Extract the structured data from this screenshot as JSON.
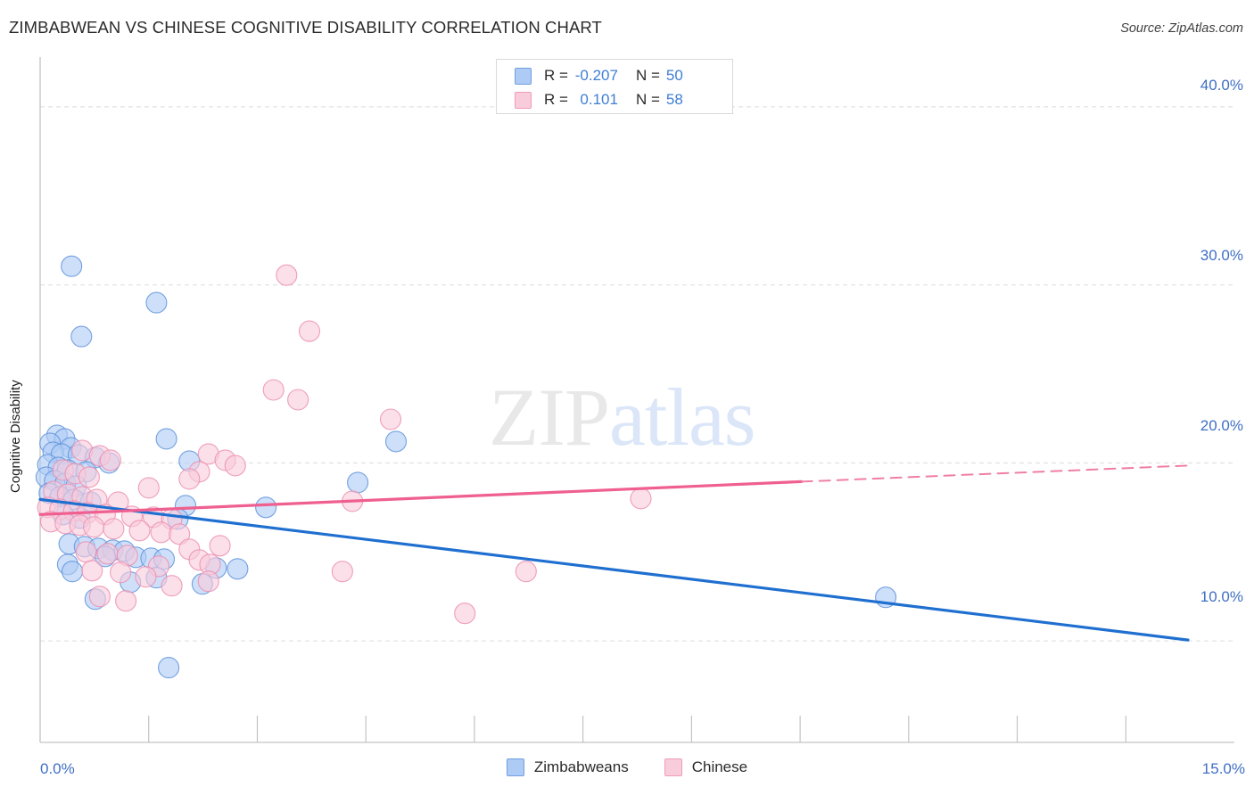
{
  "header": {
    "title": "ZIMBABWEAN VS CHINESE COGNITIVE DISABILITY CORRELATION CHART",
    "source": "Source: ZipAtlas.com"
  },
  "watermark": {
    "part1": "ZIP",
    "part2": "atlas"
  },
  "stats": {
    "rows": [
      {
        "r_label": "R =",
        "r_value": "-0.207",
        "n_label": "N =",
        "n_value": "50",
        "color": "#aecbf5"
      },
      {
        "r_label": "R =",
        "r_value": "0.101",
        "n_label": "N =",
        "n_value": "58",
        "color": "#f9ccdb"
      }
    ]
  },
  "legend": {
    "items": [
      {
        "label": "Zimbabweans",
        "color": "#aecbf5",
        "border": "#6f9ee0"
      },
      {
        "label": "Chinese",
        "color": "#f9ccdb",
        "border": "#ef9cb9"
      }
    ]
  },
  "axes": {
    "y_title": "Cognitive Disability",
    "y_ticks": [
      "40.0%",
      "30.0%",
      "20.0%",
      "10.0%"
    ],
    "x_min_label": "0.0%",
    "x_max_label": "15.0%"
  },
  "chart_data": {
    "type": "scatter",
    "title": "ZIMBABWEAN VS CHINESE COGNITIVE DISABILITY CORRELATION CHART",
    "xlabel": "",
    "ylabel": "Cognitive Disability",
    "xlim": [
      0.0,
      15.0
    ],
    "ylim": [
      4.3,
      42.8
    ],
    "x_ticks": [
      0.0,
      15.0
    ],
    "y_ticks": [
      10.0,
      20.0,
      30.0,
      40.0
    ],
    "grid": "horizontal-dashed",
    "legend_position": "bottom-center",
    "series": [
      {
        "name": "Zimbabweans",
        "color": "#aecbf5",
        "border": "#5f93da",
        "R": -0.207,
        "N": 50,
        "trendline": {
          "x0": 0.0,
          "y0": 17.95,
          "x1": 15.0,
          "y1": 10.05,
          "style": "solid"
        },
        "points": [
          [
            0.41,
            31.05
          ],
          [
            1.52,
            29.0
          ],
          [
            0.54,
            27.1
          ],
          [
            0.22,
            21.55
          ],
          [
            0.32,
            21.35
          ],
          [
            0.13,
            21.1
          ],
          [
            0.4,
            20.85
          ],
          [
            1.65,
            21.35
          ],
          [
            4.65,
            21.2
          ],
          [
            0.17,
            20.6
          ],
          [
            0.28,
            20.5
          ],
          [
            0.5,
            20.45
          ],
          [
            0.72,
            20.3
          ],
          [
            0.9,
            20.0
          ],
          [
            0.1,
            19.9
          ],
          [
            0.24,
            19.75
          ],
          [
            0.36,
            19.6
          ],
          [
            0.6,
            19.5
          ],
          [
            1.95,
            20.1
          ],
          [
            0.08,
            19.2
          ],
          [
            0.19,
            19.0
          ],
          [
            0.33,
            18.85
          ],
          [
            0.47,
            18.7
          ],
          [
            4.15,
            18.9
          ],
          [
            0.12,
            18.3
          ],
          [
            0.26,
            18.1
          ],
          [
            0.44,
            17.95
          ],
          [
            0.66,
            17.8
          ],
          [
            1.9,
            17.6
          ],
          [
            2.95,
            17.5
          ],
          [
            0.3,
            17.1
          ],
          [
            0.52,
            16.9
          ],
          [
            1.8,
            16.85
          ],
          [
            0.38,
            15.45
          ],
          [
            0.58,
            15.3
          ],
          [
            0.76,
            15.2
          ],
          [
            0.95,
            15.1
          ],
          [
            1.1,
            15.05
          ],
          [
            0.85,
            14.75
          ],
          [
            1.25,
            14.7
          ],
          [
            1.45,
            14.65
          ],
          [
            1.62,
            14.6
          ],
          [
            0.36,
            14.3
          ],
          [
            0.42,
            13.9
          ],
          [
            2.3,
            14.1
          ],
          [
            2.58,
            14.05
          ],
          [
            1.52,
            13.55
          ],
          [
            1.18,
            13.3
          ],
          [
            2.12,
            13.2
          ],
          [
            0.72,
            12.35
          ],
          [
            11.05,
            12.45
          ],
          [
            1.68,
            8.5
          ]
        ]
      },
      {
        "name": "Chinese",
        "color": "#f9ccdb",
        "border": "#ec8fb0",
        "R": 0.101,
        "N": 58,
        "trendline": {
          "x0": 0.0,
          "y0": 17.1,
          "x1": 9.95,
          "y1": 18.95,
          "style": "solid"
        },
        "trendline_extension": {
          "x0": 9.95,
          "y0": 18.95,
          "x1": 15.0,
          "y1": 19.85,
          "style": "dashed"
        },
        "points": [
          [
            3.22,
            30.55
          ],
          [
            3.52,
            27.4
          ],
          [
            3.05,
            24.1
          ],
          [
            3.37,
            23.55
          ],
          [
            4.58,
            22.45
          ],
          [
            0.55,
            20.7
          ],
          [
            0.78,
            20.4
          ],
          [
            0.92,
            20.15
          ],
          [
            2.2,
            20.5
          ],
          [
            2.42,
            20.15
          ],
          [
            2.55,
            19.85
          ],
          [
            2.08,
            19.5
          ],
          [
            0.3,
            19.6
          ],
          [
            0.46,
            19.4
          ],
          [
            0.64,
            19.2
          ],
          [
            1.95,
            19.1
          ],
          [
            1.42,
            18.6
          ],
          [
            0.18,
            18.4
          ],
          [
            0.36,
            18.25
          ],
          [
            0.55,
            18.1
          ],
          [
            0.74,
            17.95
          ],
          [
            1.02,
            17.8
          ],
          [
            0.1,
            17.5
          ],
          [
            0.26,
            17.4
          ],
          [
            0.44,
            17.3
          ],
          [
            0.62,
            17.2
          ],
          [
            0.85,
            17.1
          ],
          [
            1.2,
            17.0
          ],
          [
            1.48,
            16.95
          ],
          [
            1.72,
            16.85
          ],
          [
            4.08,
            17.85
          ],
          [
            7.85,
            18.0
          ],
          [
            0.14,
            16.7
          ],
          [
            0.33,
            16.6
          ],
          [
            0.52,
            16.5
          ],
          [
            0.7,
            16.4
          ],
          [
            0.96,
            16.3
          ],
          [
            1.3,
            16.2
          ],
          [
            1.58,
            16.1
          ],
          [
            1.82,
            16.0
          ],
          [
            2.35,
            15.35
          ],
          [
            1.95,
            15.15
          ],
          [
            0.6,
            15.0
          ],
          [
            0.88,
            14.9
          ],
          [
            1.14,
            14.8
          ],
          [
            2.08,
            14.55
          ],
          [
            2.22,
            14.3
          ],
          [
            1.55,
            14.2
          ],
          [
            0.68,
            13.95
          ],
          [
            1.05,
            13.85
          ],
          [
            1.38,
            13.6
          ],
          [
            3.95,
            13.9
          ],
          [
            6.35,
            13.9
          ],
          [
            2.2,
            13.35
          ],
          [
            1.72,
            13.1
          ],
          [
            0.78,
            12.5
          ],
          [
            1.12,
            12.25
          ],
          [
            5.55,
            11.55
          ]
        ]
      }
    ]
  }
}
